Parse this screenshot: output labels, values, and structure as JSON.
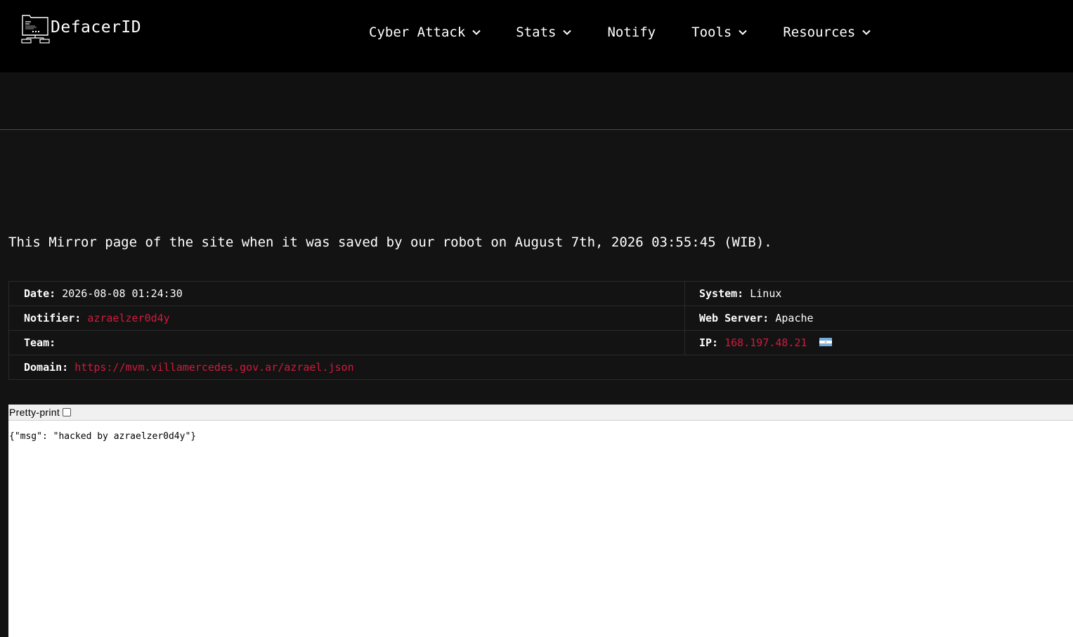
{
  "brand": {
    "name": "DefacerID"
  },
  "nav": {
    "items": [
      {
        "label": "Cyber Attack",
        "has_dropdown": true
      },
      {
        "label": "Stats",
        "has_dropdown": true
      },
      {
        "label": "Notify",
        "has_dropdown": false
      },
      {
        "label": "Tools",
        "has_dropdown": true
      },
      {
        "label": "Resources",
        "has_dropdown": true
      }
    ]
  },
  "mirror_notice": "This Mirror page of the site when it was saved by our robot on August 7th, 2026 03:55:45 (WIB).",
  "info": {
    "date_label": "Date:",
    "date_value": "2026-08-08 01:24:30",
    "system_label": "System:",
    "system_value": "Linux",
    "notifier_label": "Notifier:",
    "notifier_value": "azraelzer0d4y",
    "webserver_label": "Web Server:",
    "webserver_value": "Apache",
    "team_label": "Team:",
    "team_value": "",
    "ip_label": "IP:",
    "ip_value": "168.197.48.21",
    "ip_flag_icon": "argentina-flag-icon",
    "domain_label": "Domain:",
    "domain_value": "https://mvm.villamercedes.gov.ar/azrael.json"
  },
  "viewer": {
    "pretty_print_label": "Pretty-print",
    "pretty_print_checked": false,
    "json_text": "{\"msg\": \"hacked by azraelzer0d4y\"}"
  },
  "colors": {
    "navbar_bg": "#000000",
    "page_bg": "#131313",
    "link_red": "#d11a3d",
    "text": "#ffffff"
  }
}
